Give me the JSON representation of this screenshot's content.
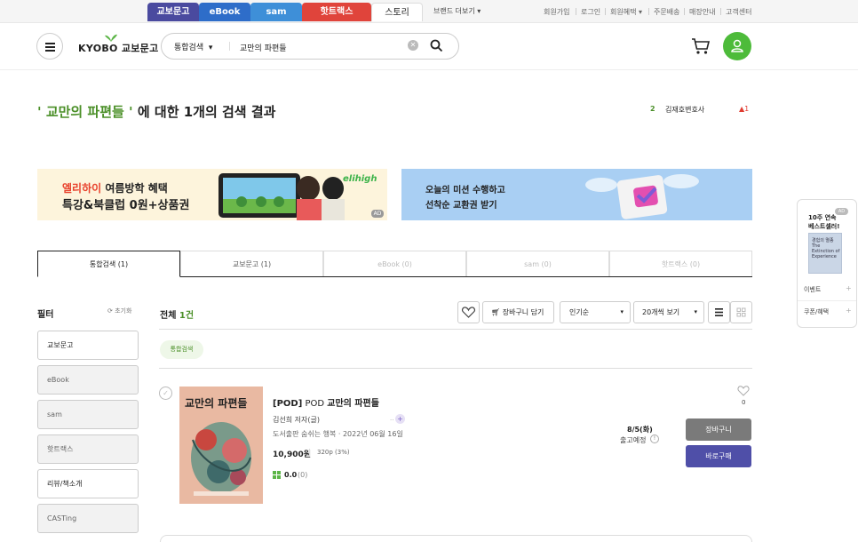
{
  "service_tabs": [
    {
      "label": "교보문고",
      "color": "#4a4a9f"
    },
    {
      "label": "eBook",
      "color": "#2e6dc9"
    },
    {
      "label": "sam",
      "color": "#3e8fd8"
    },
    {
      "label": "핫트랙스",
      "color": "#e0443b"
    },
    {
      "label": "스토리",
      "color": "#ffffff"
    }
  ],
  "brand_more": "브랜드 더보기",
  "util_links": [
    "회원가입",
    "로그인",
    "회원혜택",
    "주문배송",
    "매장안내",
    "고객센터"
  ],
  "header": {
    "logo": "KYOBO 교보문고",
    "search_category": "통합검색",
    "search_value": "교만의 파편들"
  },
  "result": {
    "keyword_label": "' 교만의 파편들 '",
    "suffix": "에 대한 1개의 검색 결과",
    "rank_num": "2",
    "rank_text": "김재호변호사",
    "rank_change": "▲1"
  },
  "banners": {
    "b1_line1_hl": "엘리하이",
    "b1_line1": " 여름방학 혜택",
    "b1_line2": "특강&북클럽 0원+상품권",
    "b1_brand": "elihigh",
    "b1_ad": "AD",
    "b2_line1": "오늘의 미션 수행하고",
    "b2_line2": "선착순 교환권 받기"
  },
  "side_widget": {
    "title1": "10주 연속",
    "title2": "베스트셀러!",
    "badge": "AD",
    "book_title": "경험의 멸종",
    "book_sub": "The Extinction of Experience",
    "item1": "이벤트",
    "item2": "쿠폰/혜택"
  },
  "tabs": [
    "통합검색 (1)",
    "교보문고 (1)",
    "eBook (0)",
    "sam (0)",
    "핫트랙스 (0)"
  ],
  "filter": {
    "title": "필터",
    "reset": "초기화",
    "items": [
      "교보문고",
      "eBook",
      "sam",
      "핫트랙스",
      "리뷰/책소개",
      "CASTing"
    ]
  },
  "toolbar": {
    "total_label": "전체",
    "total_count": "1건",
    "cart_btn": "장바구니 담기",
    "sort": "인기순",
    "per_page": "20개씩 보기",
    "chip": "통합검색"
  },
  "product": {
    "cover_title": "교만의 파편들",
    "tag": "[POD]",
    "title_prefix": "POD",
    "title": "교만의 파편들",
    "author": "김선희 저자(글)",
    "publisher": "도서출판 숨쉬는 행복 · 2022년 06월 16일",
    "price": "10,900원",
    "point": "320p (3%)",
    "rating": "0.0",
    "review_count": "(0)",
    "likes": "0",
    "ship_date": "8/5(화)",
    "ship_note": "출고예정",
    "cart_btn": "장바구니",
    "buy_btn": "바로구매"
  }
}
